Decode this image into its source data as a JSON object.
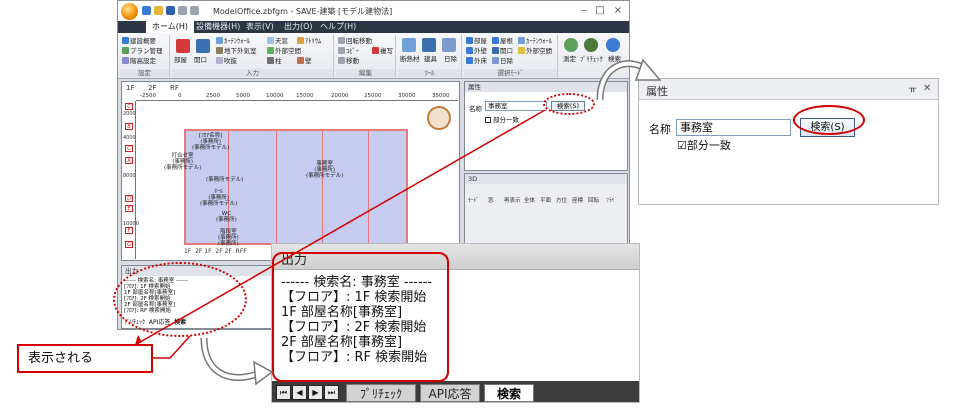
{
  "window": {
    "title": "ModelOffice.zbfgm - SAVE-建築 [モデル建物法]",
    "controls": [
      "–",
      "□",
      "×"
    ]
  },
  "menu_tabs": [
    "ホーム(H)",
    "設備機器(H)",
    "表示(V)",
    "出力(O)",
    "ヘルプ(H)"
  ],
  "ribbon": {
    "groups": [
      {
        "label": "設定",
        "items": [
          "建設概要",
          "プラン管理",
          "階高設定"
        ]
      },
      {
        "label": "入力",
        "items": [
          "部屋",
          "開口",
          "ｶｰﾃﾝｳｫｰﾙ",
          "天窓",
          "ｱﾄﾘｳﾑ",
          "外部空間",
          "地下外気室",
          "吹抜",
          "柱",
          "壁"
        ]
      },
      {
        "label": "編集",
        "items": [
          "回転移動",
          "ｺﾋﾟｰ",
          "移動",
          "複写"
        ]
      },
      {
        "label": "ﾂｰﾙ",
        "items": [
          "断熱材",
          "建具",
          "日除"
        ]
      },
      {
        "label": "選択ﾓｰﾄﾞ",
        "items": [
          "部屋",
          "屋根",
          "ｶｰﾃﾝｳｫｰﾙ",
          "外壁",
          "開口",
          "外部空間",
          "外床",
          "日除"
        ]
      },
      {
        "label": "",
        "items": [
          "測定",
          "ﾌﾟﾘﾁｪｯｸ",
          "検索"
        ]
      }
    ]
  },
  "canvas": {
    "floors": [
      "1F",
      "2F",
      "RF"
    ],
    "ruler_x": [
      "-2500",
      "0",
      "2500",
      "5000",
      "10000",
      "15000",
      "20000",
      "25000",
      "30000",
      "35000"
    ],
    "ruler_y": [
      "2000",
      "4000",
      "8000",
      "10000"
    ],
    "row_marks": [
      "C",
      "B",
      "C",
      "A",
      "D",
      "E",
      "F",
      "G"
    ],
    "rooms": [
      "[ﾌﾛｱ名称]\n(事務所)\n(事務所モデル)",
      "打合せ室\n(事務所)\n(事務所モデル)",
      "(事務所モデル)",
      "ﾎｰﾙ\n(事務所)\n(事務所モデル)",
      "WC\n(事務所)",
      "事務室\n(事務所)\n(事務所モデル)",
      "階段室\n(事務所)\n(事務所)"
    ],
    "zoom_tabs": [
      "1F",
      "2F 1F",
      "2F 2F",
      "RFF"
    ]
  },
  "prop_small": {
    "title": "属性",
    "label": "名称",
    "value": "事務室",
    "button": "検索(S)",
    "checkbox": "部分一致"
  },
  "pane_3d": {
    "title": "3D",
    "tools": [
      "ﾓｰﾄﾞ",
      "窓",
      "再表示",
      "全体",
      "平面",
      "方位",
      "座標",
      "回転",
      "ﾌﾗｲ"
    ]
  },
  "out_small": {
    "title": "出力",
    "lines": [
      "------ 検索名: 事務室 ------",
      "[ﾌﾛｱ]: 1F 検索開始",
      "1F 部屋名称[事務室]",
      "[ﾌﾛｱ]: 2F 検索開始",
      "2F 部屋名称[事務室]",
      "[ﾌﾛｱ]: RF 検索開始"
    ],
    "tabs": [
      "ﾌﾟﾘﾁｪｯｸ",
      "API応答",
      "検索"
    ]
  },
  "output_zoom": {
    "title": "出力",
    "lines": [
      "------ 検索名: 事務室 ------",
      "【フロア】: 1F 検索開始",
      "1F 部屋名称[事務室]",
      "【フロア】: 2F 検索開始",
      "2F 部屋名称[事務室]",
      "【フロア】: RF 検索開始"
    ],
    "nav_buttons": [
      "⏮",
      "◀",
      "▶",
      "⏭"
    ],
    "tabs": [
      "ﾌﾟﾘﾁｪｯｸ",
      "API応答",
      "検索"
    ],
    "active_tab": "検索"
  },
  "prop_zoom": {
    "title": "属性",
    "pin_icon": "ᚂ",
    "close_icon": "✕",
    "label": "名称",
    "value": "事務室",
    "button": "検索(S)",
    "checkbox_mark": "☑",
    "checkbox": "部分一致"
  },
  "callout": {
    "text": "表示される"
  },
  "colors": {
    "highlight": "#d40000",
    "room_fill": "#c6cbef",
    "wall": "#e47b7b",
    "menu_bar": "#2b3544"
  }
}
